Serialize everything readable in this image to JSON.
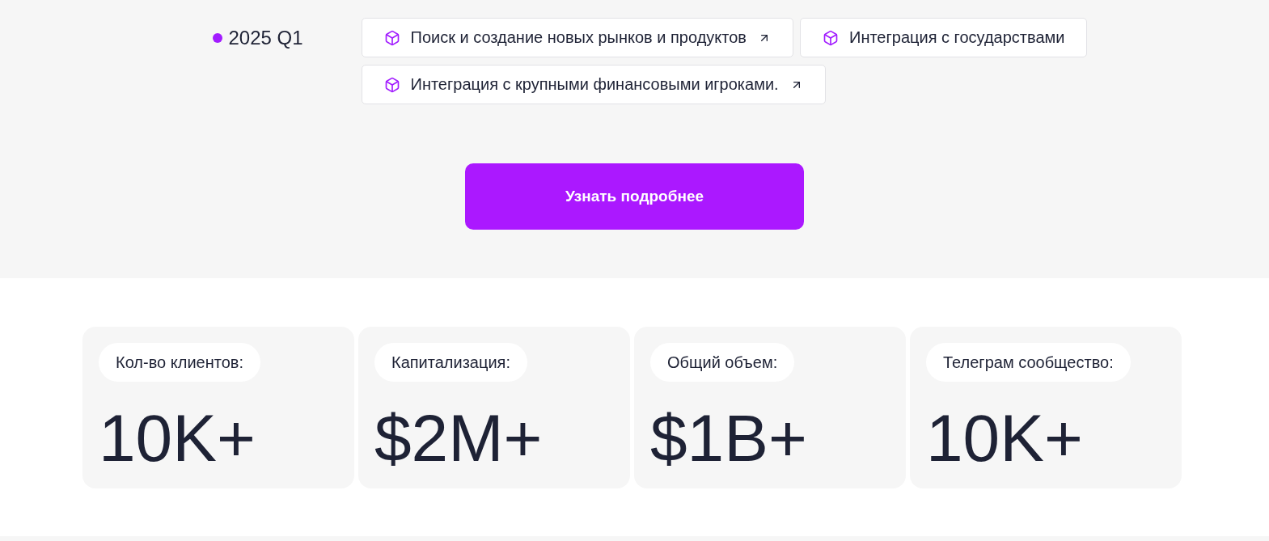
{
  "timeline": {
    "period": "2025 Q1",
    "items": [
      {
        "label": "Поиск и создание новых рынков и продуктов",
        "external_link": true
      },
      {
        "label": "Интеграция с государствами",
        "external_link": false
      },
      {
        "label": "Интеграция с крупными финансовыми игроками.",
        "external_link": true
      }
    ]
  },
  "cta_button": {
    "label": "Узнать подробнее"
  },
  "stats": [
    {
      "label": "Кол-во клиентов:",
      "value": "10K+"
    },
    {
      "label": "Капитализация:",
      "value": "$2M+"
    },
    {
      "label": "Общий объем:",
      "value": "$1B+"
    },
    {
      "label": "Телеграм сообщество:",
      "value": "10K+"
    }
  ]
}
